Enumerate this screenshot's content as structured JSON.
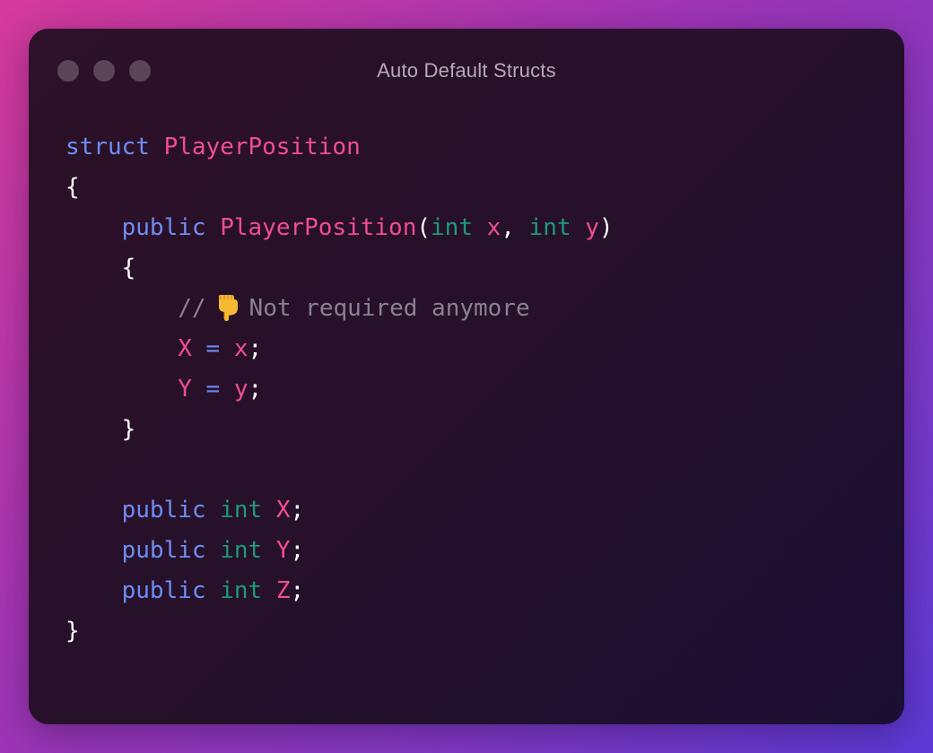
{
  "window": {
    "title": "Auto Default Structs",
    "controls": [
      "close-dot",
      "minimize-dot",
      "maximize-dot"
    ]
  },
  "code": {
    "line1": {
      "keyword": "struct",
      "name": "PlayerPosition"
    },
    "line2": {
      "open_brace": "{"
    },
    "line3": {
      "modifier": "public",
      "name": "PlayerPosition",
      "open_paren": "(",
      "param1_type": "int",
      "param1_name": "x",
      "comma": ",",
      "param2_type": "int",
      "param2_name": "y",
      "close_paren": ")"
    },
    "line4": {
      "open_brace": "{"
    },
    "line5": {
      "comment_prefix": "//",
      "emoji_icon": "pointing-down-hand-icon",
      "comment_text": "Not required anymore"
    },
    "line6": {
      "target": "X",
      "op": "=",
      "value": "x",
      "semi": ";"
    },
    "line7": {
      "target": "Y",
      "op": "=",
      "value": "y",
      "semi": ";"
    },
    "line8": {
      "close_brace": "}"
    },
    "line10": {
      "modifier": "public",
      "type": "int",
      "name": "X",
      "semi": ";"
    },
    "line11": {
      "modifier": "public",
      "type": "int",
      "name": "Y",
      "semi": ";"
    },
    "line12": {
      "modifier": "public",
      "type": "int",
      "name": "Z",
      "semi": ";"
    },
    "line13": {
      "close_brace": "}"
    }
  },
  "colors": {
    "keyword": "#6e8df2",
    "type": "#1c9a78",
    "identifier": "#f04d95",
    "comment": "#8a8191",
    "punctuation": "#ffffff",
    "title": "#b6a9b8"
  }
}
